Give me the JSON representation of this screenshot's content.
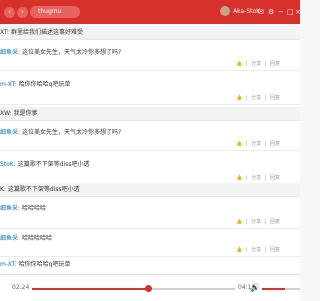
{
  "search": {
    "text": "thugmu"
  },
  "header": {
    "username": "Aka-StoK"
  },
  "icons": {
    "back": "chevron-left-icon",
    "forward": "chevron-right-icon",
    "search": "search-icon",
    "mail": "mail-icon",
    "settings": "gear-icon",
    "minimize": "minimize-icon",
    "maximize": "maximize-icon",
    "close": "close-icon",
    "volume": "volume-icon"
  },
  "colors": {
    "brand": "#d8302b",
    "link": "#0c73c2"
  },
  "comments": [
    {
      "user": "",
      "reply_quote": "XT: 群里给我们描述这事好难受",
      "text": "",
      "reply_label": "",
      "share_label": "",
      "sep": "",
      "like": ""
    },
    {
      "user": "细鱼采:",
      "reply_quote": "",
      "text": "这位美女先生，天气太冷你多想了吗?",
      "reply_label": "回复",
      "share_label": "分享",
      "sep": "|",
      "like": ""
    },
    {
      "user": "m-XT:",
      "reply_quote": "",
      "text": "哈你你哈哈q吧玩单",
      "reply_label": "回复",
      "share_label": "分享",
      "sep": "|",
      "like": ""
    },
    {
      "user": "",
      "reply_quote": "XW: 我是你爹",
      "text": "",
      "reply_label": "",
      "share_label": "",
      "sep": "",
      "like": ""
    },
    {
      "user": "细鱼采:",
      "reply_quote": "",
      "text": "这位美女先生，天气太冷你多想了吗?",
      "reply_label": "回复",
      "share_label": "分享",
      "sep": "|",
      "like": ""
    },
    {
      "user": "StoK:",
      "reply_quote": "",
      "text": "这篇歌不下架等diss吧小透",
      "reply_label": "回复",
      "share_label": "分享",
      "sep": "|",
      "like": ""
    },
    {
      "user": "",
      "reply_quote": "K: 这篇歌不下架等diss吧小透",
      "text": "",
      "reply_label": "",
      "share_label": "",
      "sep": "",
      "like": ""
    },
    {
      "user": "细鱼采:",
      "reply_quote": "",
      "text": "哈哈哈哈",
      "reply_label": "回复",
      "share_label": "分享",
      "sep": "|",
      "like": ""
    },
    {
      "user": "细鱼采:",
      "reply_quote": "",
      "text": "哈哈哈哈哈",
      "reply_label": "回复",
      "share_label": "分享",
      "sep": "|",
      "like": ""
    },
    {
      "user": "m-XT:",
      "reply_quote": "",
      "text": "哈你你哈哈q吧玩单",
      "reply_label": "回复",
      "share_label": "分享",
      "sep": "|",
      "like": ""
    }
  ],
  "player": {
    "current_time": "02:24",
    "duration": "04:10",
    "progress_fraction": 0.576,
    "volume_fraction": 0.6
  }
}
